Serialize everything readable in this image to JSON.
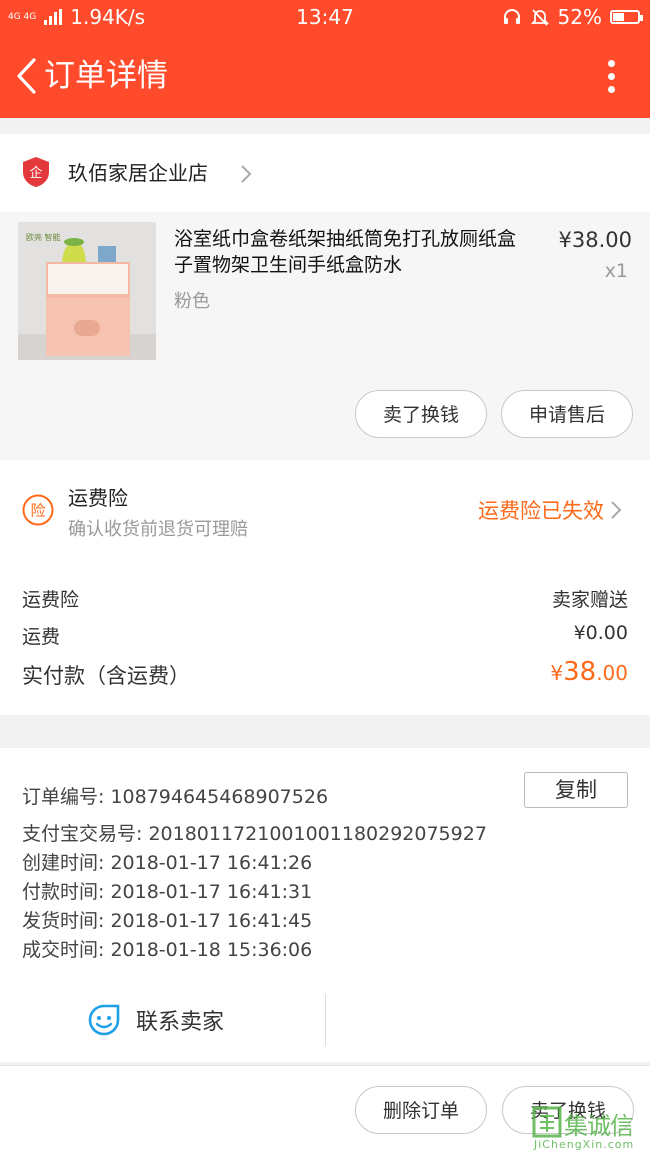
{
  "status_bar": {
    "network": "4G 4G",
    "speed": "1.94K/s",
    "time": "13:47",
    "battery": "52%",
    "battery_level": 0.52
  },
  "header": {
    "title": "订单详情"
  },
  "shop": {
    "name": "玖佰家居企业店",
    "logo_char": "企"
  },
  "product": {
    "name": "浴室纸巾盒卷纸架抽纸筒免打孔放厕纸盒子置物架卫生间手纸盒防水",
    "spec": "粉色",
    "price": "¥38.00",
    "qty": "x1",
    "thumb_label": "欧亮 智能",
    "actions": [
      "卖了换钱",
      "申请售后"
    ]
  },
  "insurance": {
    "icon_char": "险",
    "title": "运费险",
    "subtitle": "确认收货前退货可理赔",
    "status": "运费险已失效"
  },
  "summary": {
    "insurance_label": "运费险",
    "insurance_value": "卖家赠送",
    "shipping_label": "运费",
    "shipping_value": "¥0.00",
    "total_label": "实付款（含运费）",
    "total_currency": "¥",
    "total_int": "38",
    "total_dec": ".00"
  },
  "order_info": {
    "copy_label": "复制",
    "lines": [
      "订单编号:  108794645468907526",
      "支付宝交易号:  2018011721001001180292075927",
      "创建时间:  2018-01-17 16:41:26",
      "付款时间:  2018-01-17 16:41:31",
      "发货时间:  2018-01-17 16:41:45",
      "成交时间:  2018-01-18 15:36:06"
    ],
    "contact_label": "联系卖家"
  },
  "bottom": {
    "buttons": [
      "删除订单",
      "卖了换钱"
    ]
  },
  "watermark": {
    "text": "集诚信",
    "sub": "JiChengXin.com"
  },
  "colors": {
    "brand": "#ff4b2b",
    "accent": "#ff6a1a"
  }
}
